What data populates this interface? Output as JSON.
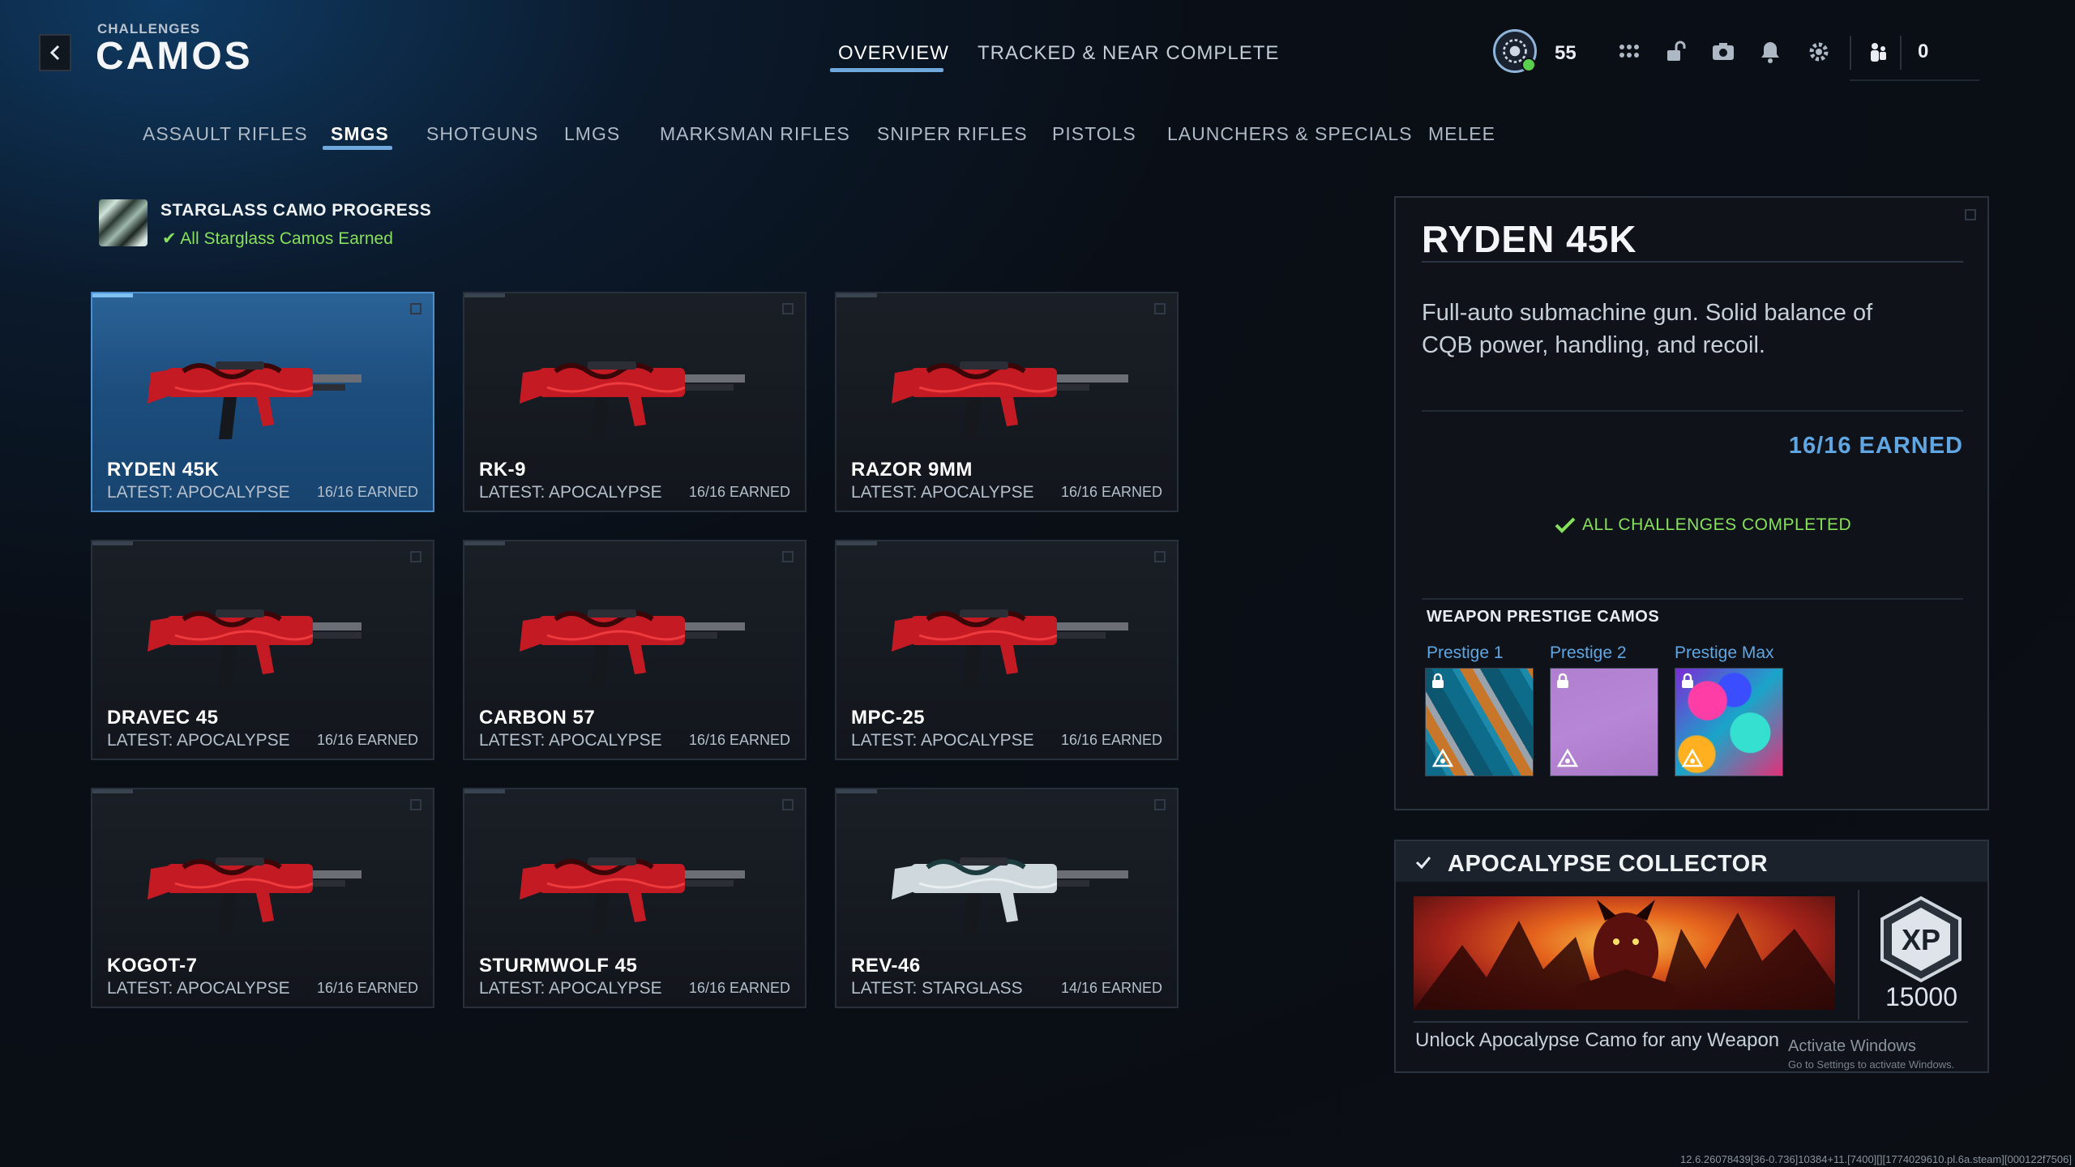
{
  "header": {
    "kicker": "CHALLENGES",
    "title": "CAMOS",
    "tabs": [
      "OVERVIEW",
      "TRACKED & NEAR COMPLETE"
    ],
    "active_tab": "OVERVIEW",
    "level": "55",
    "friends_count": "0"
  },
  "categories": {
    "items": [
      "ASSAULT RIFLES",
      "SMGS",
      "SHOTGUNS",
      "LMGS",
      "MARKSMAN RIFLES",
      "SNIPER RIFLES",
      "PISTOLS",
      "LAUNCHERS & SPECIALS",
      "MELEE"
    ],
    "active": "SMGS"
  },
  "starglass": {
    "title": "STARGLASS CAMO PROGRESS",
    "status": "All Starglass Camos Earned"
  },
  "weapons": [
    {
      "name": "RYDEN 45K",
      "latest": "LATEST: APOCALYPSE",
      "earned": "16/16 EARNED",
      "selected": true
    },
    {
      "name": "RK-9",
      "latest": "LATEST: APOCALYPSE",
      "earned": "16/16 EARNED",
      "selected": false
    },
    {
      "name": "RAZOR 9MM",
      "latest": "LATEST: APOCALYPSE",
      "earned": "16/16 EARNED",
      "selected": false
    },
    {
      "name": "DRAVEC 45",
      "latest": "LATEST: APOCALYPSE",
      "earned": "16/16 EARNED",
      "selected": false
    },
    {
      "name": "CARBON 57",
      "latest": "LATEST: APOCALYPSE",
      "earned": "16/16 EARNED",
      "selected": false
    },
    {
      "name": "MPC-25",
      "latest": "LATEST: APOCALYPSE",
      "earned": "16/16 EARNED",
      "selected": false
    },
    {
      "name": "KOGOT-7",
      "latest": "LATEST: APOCALYPSE",
      "earned": "16/16 EARNED",
      "selected": false
    },
    {
      "name": "STURMWOLF 45",
      "latest": "LATEST: APOCALYPSE",
      "earned": "16/16 EARNED",
      "selected": false
    },
    {
      "name": "REV-46",
      "latest": "LATEST: STARGLASS",
      "earned": "14/16 EARNED",
      "selected": false
    }
  ],
  "detail": {
    "title": "RYDEN 45K",
    "description": "Full-auto submachine gun. Solid balance of CQB power, handling, and recoil.",
    "earned": "16/16 EARNED",
    "status": "ALL CHALLENGES COMPLETED",
    "prestige_heading": "WEAPON PRESTIGE CAMOS",
    "prestige": [
      {
        "label": "Prestige 1",
        "locked": true
      },
      {
        "label": "Prestige 2",
        "locked": true
      },
      {
        "label": "Prestige Max",
        "locked": true
      }
    ]
  },
  "collector": {
    "title": "APOCALYPSE COLLECTOR",
    "reward_xp": "15000",
    "reward_icon": "XP",
    "description": "Unlock Apocalypse Camo for any Weapon"
  },
  "watermark": {
    "line1": "Activate Windows",
    "line2": "Go to Settings to activate Windows."
  },
  "build_string": "12.6.26078439[36-0.736]10384+11.[7400][][1774029610.pl.6a.steam][000122f7506]",
  "colors": {
    "accent_blue": "#6fa9dc",
    "earned_blue": "#5fa6e3",
    "success_green": "#86e05a",
    "camo_red": "#c41a24"
  }
}
